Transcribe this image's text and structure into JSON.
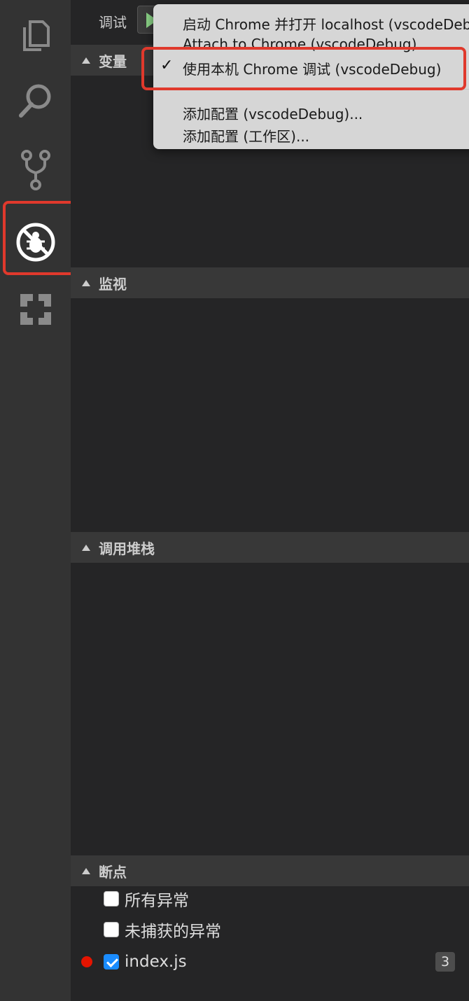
{
  "activity_bar": {
    "icons": [
      "files-icon",
      "search-icon",
      "source-control-icon",
      "debug-icon",
      "extensions-icon"
    ],
    "active": "debug-icon",
    "highlight_color": "#e0392c"
  },
  "debug_toolbar": {
    "title": "调试",
    "run_icon": "play-icon",
    "run_color": "#89d185"
  },
  "config_menu": {
    "items": [
      {
        "label": "启动 Chrome 并打开 localhost (vscodeDebug)",
        "checked": false
      },
      {
        "label": "Attach to Chrome (vscodeDebug)",
        "checked": false
      },
      {
        "label": "使用本机 Chrome 调试 (vscodeDebug)",
        "checked": true
      },
      {
        "label": "添加配置 (vscodeDebug)...",
        "checked": false
      },
      {
        "label": "添加配置 (工作区)...",
        "checked": false
      }
    ],
    "check_mark": "✓"
  },
  "sections": {
    "variables": "变量",
    "watch": "监视",
    "call_stack": "调用堆栈",
    "breakpoints": "断点"
  },
  "breakpoints": [
    {
      "label": "所有异常",
      "checked": false
    },
    {
      "label": "未捕获的异常",
      "checked": false
    },
    {
      "label": "index.js",
      "checked": true,
      "count": "3",
      "dot_color": "#e51400"
    }
  ]
}
